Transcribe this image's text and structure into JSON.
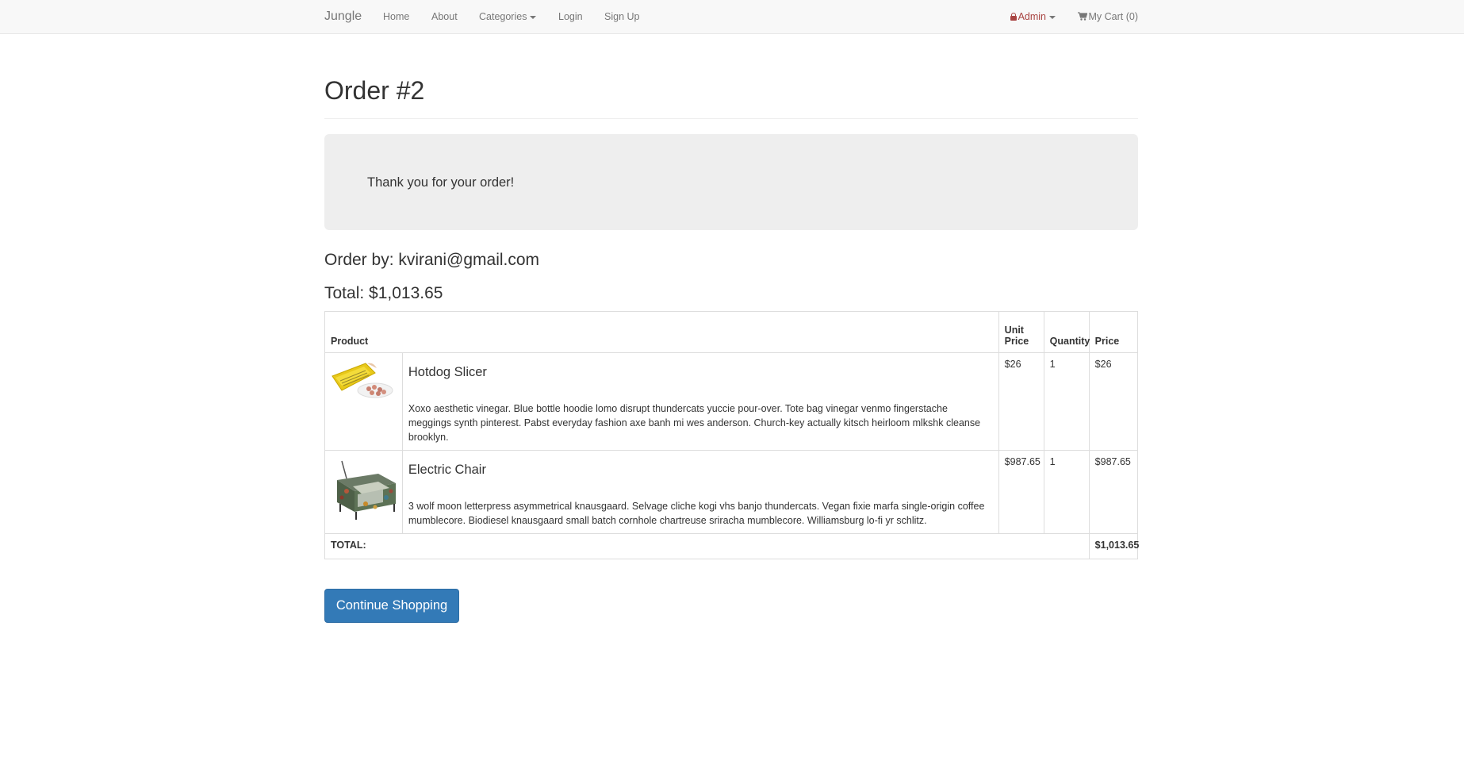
{
  "navbar": {
    "brand": "Jungle",
    "links": [
      "Home",
      "About",
      "Categories",
      "Login",
      "Sign Up"
    ],
    "admin_label": "Admin",
    "cart_label": "My Cart (0)"
  },
  "page": {
    "title": "Order #2",
    "thank_you": "Thank you for your order!",
    "order_by": "Order by: kvirani@gmail.com",
    "total": "Total: $1,013.65"
  },
  "table": {
    "headers": {
      "product": "Product",
      "unit_price": "Unit Price",
      "quantity": "Quantity",
      "price": "Price"
    },
    "rows": [
      {
        "name": "Hotdog Slicer",
        "description": "Xoxo aesthetic vinegar. Blue bottle hoodie lomo disrupt thundercats yuccie pour-over. Tote bag vinegar venmo fingerstache meggings synth pinterest. Pabst everyday fashion axe banh mi wes anderson. Church-key actually kitsch heirloom mlkshk cleanse brooklyn.",
        "unit_price": "$26",
        "quantity": "1",
        "price": "$26"
      },
      {
        "name": "Electric Chair",
        "description": "3 wolf moon letterpress asymmetrical knausgaard. Selvage cliche kogi vhs banjo thundercats. Vegan fixie marfa single-origin coffee mumblecore. Biodiesel knausgaard small batch cornhole chartreuse sriracha mumblecore. Williamsburg lo-fi yr schlitz.",
        "unit_price": "$987.65",
        "quantity": "1",
        "price": "$987.65"
      }
    ],
    "total_label": "TOTAL:",
    "total_value": "$1,013.65"
  },
  "actions": {
    "continue_label": "Continue Shopping"
  },
  "colors": {
    "primary": "#337ab7",
    "admin": "#a94442",
    "navbar_bg": "#f8f8f8",
    "jumbotron_bg": "#eeeeee"
  }
}
